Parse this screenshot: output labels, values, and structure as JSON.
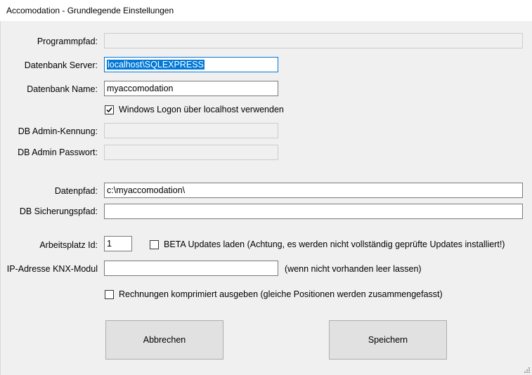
{
  "window": {
    "title": "Accomodation - Grundlegende Einstellungen"
  },
  "form": {
    "programmpfad": {
      "label": "Programmpfad:",
      "value": ""
    },
    "db_server": {
      "label": "Datenbank Server:",
      "value": "localhost\\SQLEXPRESS"
    },
    "db_name": {
      "label": "Datenbank Name:",
      "value": "myaccomodation"
    },
    "windows_logon": {
      "label": "Windows Logon über localhost verwenden",
      "checked": true
    },
    "db_admin_kennung": {
      "label": "DB Admin-Kennung:",
      "value": ""
    },
    "db_admin_passwort": {
      "label": "DB Admin Passwort:",
      "value": ""
    },
    "datenpfad": {
      "label": "Datenpfad:",
      "value": "c:\\myaccomodation\\"
    },
    "db_sicherungspfad": {
      "label": "DB Sicherungspfad:",
      "value": ""
    },
    "arbeitsplatz_id": {
      "label": "Arbeitsplatz Id:",
      "value": "1"
    },
    "beta_updates": {
      "label": "BETA Updates laden (Achtung, es werden nicht vollständig geprüfte Updates installiert!)",
      "checked": false
    },
    "ip_knx": {
      "label": "IP-Adresse KNX-Modul",
      "value": "",
      "hint": "(wenn nicht vorhanden leer lassen)"
    },
    "rechnungen": {
      "label": "Rechnungen komprimiert ausgeben (gleiche Positionen werden zusammengefasst)",
      "checked": false
    }
  },
  "buttons": {
    "cancel": "Abbrechen",
    "save": "Speichern"
  },
  "icons": {
    "checkmark": "checkmark-icon",
    "grip": "resize-grip-icon"
  },
  "colors": {
    "accent": "#0078d7",
    "background": "#f0f0f0",
    "button": "#e1e1e1"
  }
}
